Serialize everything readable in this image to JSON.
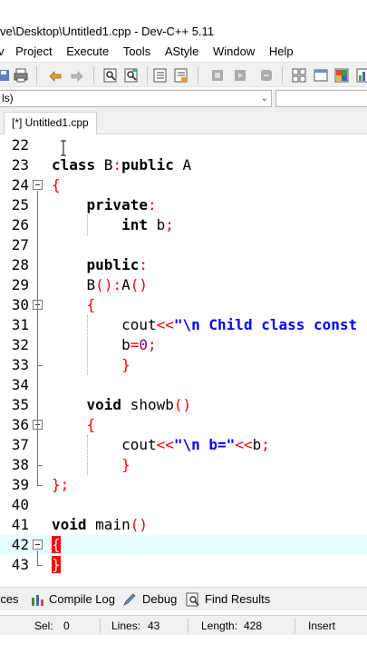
{
  "window": {
    "title": "ve\\Desktop\\Untitled1.cpp - Dev-C++ 5.11"
  },
  "menu": [
    "v",
    "Project",
    "Execute",
    "Tools",
    "AStyle",
    "Window",
    "Help"
  ],
  "toolbar": {
    "icons": [
      "printer-icon",
      "undo-icon",
      "redo-icon",
      "find-icon",
      "replace-icon",
      "indent-icon",
      "unindent-icon",
      "compile-icon",
      "run-icon",
      "stop-icon",
      "new-class-icon",
      "new-window-icon",
      "layout-icon",
      "chart-icon"
    ]
  },
  "class_combo": {
    "value": "ls)"
  },
  "editor_tab": {
    "label": "[*] Untitled1.cpp"
  },
  "code_lines": [
    {
      "n": "22",
      "text": ""
    },
    {
      "n": "23",
      "text": "class B:public A"
    },
    {
      "n": "24",
      "text": "{"
    },
    {
      "n": "25",
      "text": "    private:"
    },
    {
      "n": "26",
      "text": "        int b;"
    },
    {
      "n": "27",
      "text": ""
    },
    {
      "n": "28",
      "text": "    public:"
    },
    {
      "n": "29",
      "text": "    B():A()"
    },
    {
      "n": "30",
      "text": "    {"
    },
    {
      "n": "31",
      "text": "        cout<<\"\\n Child class const"
    },
    {
      "n": "32",
      "text": "        b=0;"
    },
    {
      "n": "33",
      "text": "        }"
    },
    {
      "n": "34",
      "text": ""
    },
    {
      "n": "35",
      "text": "    void showb()"
    },
    {
      "n": "36",
      "text": "    {"
    },
    {
      "n": "37",
      "text": "        cout<<\"\\n b=\"<<b;"
    },
    {
      "n": "38",
      "text": "        }"
    },
    {
      "n": "39",
      "text": "};"
    },
    {
      "n": "40",
      "text": ""
    },
    {
      "n": "41",
      "text": "void main()"
    },
    {
      "n": "42",
      "text": "{"
    },
    {
      "n": "43",
      "text": "}"
    }
  ],
  "bottom_tabs": [
    {
      "label": "rces",
      "icon": "resources-icon"
    },
    {
      "label": "Compile Log",
      "icon": "compile-log-icon"
    },
    {
      "label": "Debug",
      "icon": "debug-icon"
    },
    {
      "label": "Find Results",
      "icon": "find-results-icon"
    }
  ],
  "status": {
    "sel_label": "Sel:",
    "sel_value": "0",
    "lines_label": "Lines:",
    "lines_value": "43",
    "length_label": "Length:",
    "length_value": "428",
    "mode": "Insert"
  }
}
